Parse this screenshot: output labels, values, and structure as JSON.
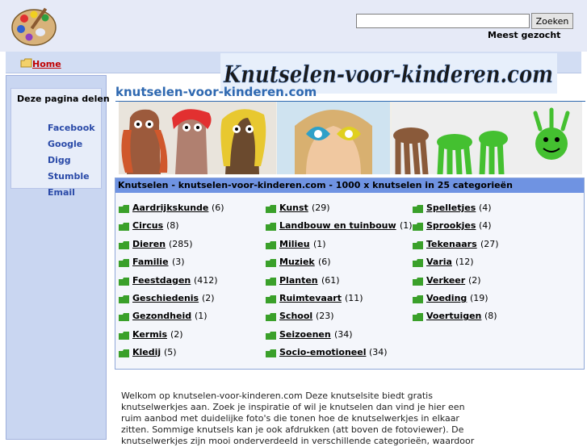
{
  "header": {
    "search_placeholder": "",
    "search_button": "Zoeken",
    "popular_label": "Meest gezocht"
  },
  "nav": {
    "home_label": "Home"
  },
  "logo": {
    "text": "Knutselen-voor-kinderen.com"
  },
  "sidebar": {
    "share_title": "Deze pagina delen",
    "links": [
      "Facebook",
      "Google",
      "Digg",
      "Stumble",
      "Email"
    ]
  },
  "main": {
    "title": "knutselen-voor-kinderen.com",
    "categories_heading": "Knutselen - knutselen-voor-kinderen.com - 1000 x knutselen in 25 categorieën",
    "columns": [
      [
        {
          "name": "Aardrijkskunde",
          "count": "(6)"
        },
        {
          "name": "Circus",
          "count": "(8)"
        },
        {
          "name": "Dieren",
          "count": "(285)"
        },
        {
          "name": "Familie",
          "count": "(3)"
        },
        {
          "name": "Feestdagen",
          "count": "(412)"
        },
        {
          "name": "Geschiedenis",
          "count": "(2)"
        },
        {
          "name": "Gezondheid",
          "count": "(1)"
        },
        {
          "name": "Kermis",
          "count": "(2)"
        },
        {
          "name": "Kledij",
          "count": "(5)"
        }
      ],
      [
        {
          "name": "Kunst",
          "count": "(29)"
        },
        {
          "name": "Landbouw en tuinbouw",
          "count": "(1)"
        },
        {
          "name": "Milieu",
          "count": "(1)"
        },
        {
          "name": "Muziek",
          "count": "(6)"
        },
        {
          "name": "Planten",
          "count": "(61)"
        },
        {
          "name": "Ruimtevaart",
          "count": "(11)"
        },
        {
          "name": "School",
          "count": "(23)"
        },
        {
          "name": "Seizoenen",
          "count": "(34)"
        },
        {
          "name": "Socio-emotioneel",
          "count": "(34)"
        }
      ],
      [
        {
          "name": "Spelletjes",
          "count": "(4)"
        },
        {
          "name": "Sprookjes",
          "count": "(4)"
        },
        {
          "name": "Tekenaars",
          "count": "(27)"
        },
        {
          "name": "Varia",
          "count": "(12)"
        },
        {
          "name": "Verkeer",
          "count": "(2)"
        },
        {
          "name": "Voeding",
          "count": "(19)"
        },
        {
          "name": "Voertuigen",
          "count": "(8)"
        }
      ]
    ],
    "welcome_lines": [
      "Welkom op knutselen-voor-kinderen.com Deze knutselsite biedt gratis",
      "knutselwerkjes aan. Zoek je inspiratie of wil je knutselen dan vind je hier een",
      "ruim aanbod met duidelijke foto's die tonen hoe de knutselwerkjes in elkaar",
      "zitten. Sommige knutsels kan je ook afdrukken (att boven de fotoviewer). De",
      "knutselwerkjes zijn mooi onderverdeeld in verschillende categorieën, waardoor"
    ]
  },
  "colors": {
    "header_bg": "#e6eaf7",
    "nav_bg": "#d2ddf3",
    "sidebar_bg": "#c9d6f1",
    "category_header": "#6f93e2",
    "title_blue": "#2e68b0",
    "link_blue": "#2a4aa8",
    "home_red": "#c00000",
    "folder_green": "#3aa02a"
  }
}
